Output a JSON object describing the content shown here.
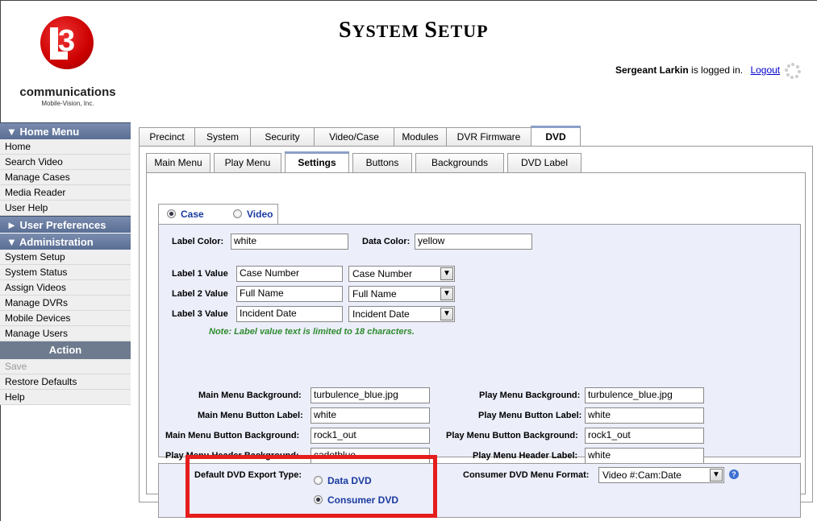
{
  "logo": {
    "text": "communications",
    "subtext": "Mobile-Vision, Inc."
  },
  "header": {
    "title": "System Setup",
    "user_name": "Sergeant Larkin",
    "login_text": "is logged in.",
    "logout_label": "Logout"
  },
  "sidebar": {
    "home_menu_title": "Home Menu",
    "home_items": [
      "Home",
      "Search Video",
      "Manage Cases",
      "Media Reader",
      "User Help"
    ],
    "user_prefs_title": "User Preferences",
    "admin_title": "Administration",
    "admin_items": [
      "System Setup",
      "System Status",
      "Assign Videos",
      "Manage DVRs",
      "Mobile Devices",
      "Manage Users"
    ],
    "action_title": "Action",
    "action_items": [
      "Save",
      "Restore Defaults",
      "Help"
    ]
  },
  "tabs": [
    "Precinct",
    "System",
    "Security",
    "Video/Case",
    "Modules",
    "DVR Firmware",
    "DVD"
  ],
  "subtabs": [
    "Main Menu",
    "Play Menu",
    "Settings",
    "Buttons",
    "Backgrounds",
    "DVD Label"
  ],
  "mode": {
    "case_label": "Case",
    "video_label": "Video",
    "selected": "Case"
  },
  "labels": {
    "label_color_label": "Label Color:",
    "label_color": "white",
    "data_color_label": "Data Color:",
    "data_color": "yellow",
    "label1_label": "Label 1 Value",
    "label1_value": "Case Number",
    "label1_select": "Case Number",
    "label2_label": "Label 2 Value",
    "label2_value": "Full Name",
    "label2_select": "Full Name",
    "label3_label": "Label 3 Value",
    "label3_value": "Incident Date",
    "label3_select": "Incident Date",
    "note": "Note: Label value text is limited to 18 characters."
  },
  "menus": {
    "main_bg_label": "Main Menu Background:",
    "main_bg": "turbulence_blue.jpg",
    "play_bg_label": "Play Menu Background:",
    "play_bg": "turbulence_blue.jpg",
    "main_btn_label_label": "Main Menu Button Label:",
    "main_btn_label": "white",
    "play_btn_label_label": "Play Menu Button Label:",
    "play_btn_label": "white",
    "main_btn_bg_label": "Main Menu Button Background:",
    "main_btn_bg": "rock1_out",
    "play_btn_bg_label": "Play Menu Button Background:",
    "play_btn_bg": "rock1_out",
    "play_hdr_bg_label": "Play Menu Header Background:",
    "play_hdr_bg": "cadetblue",
    "play_hdr_label_label": "Play Menu Header Label:",
    "play_hdr_label": "white"
  },
  "export": {
    "default_type_label": "Default DVD Export Type:",
    "data_dvd": "Data DVD",
    "consumer_dvd": "Consumer DVD",
    "selected": "Consumer DVD",
    "consumer_format_label": "Consumer DVD Menu Format:",
    "consumer_format": "Video #:Cam:Date"
  },
  "colors": {
    "highlight": "#e51d1d",
    "note_green": "#2e8b2e",
    "link_blue": "#1a3a9e",
    "panel_bg": "#eceefa"
  }
}
